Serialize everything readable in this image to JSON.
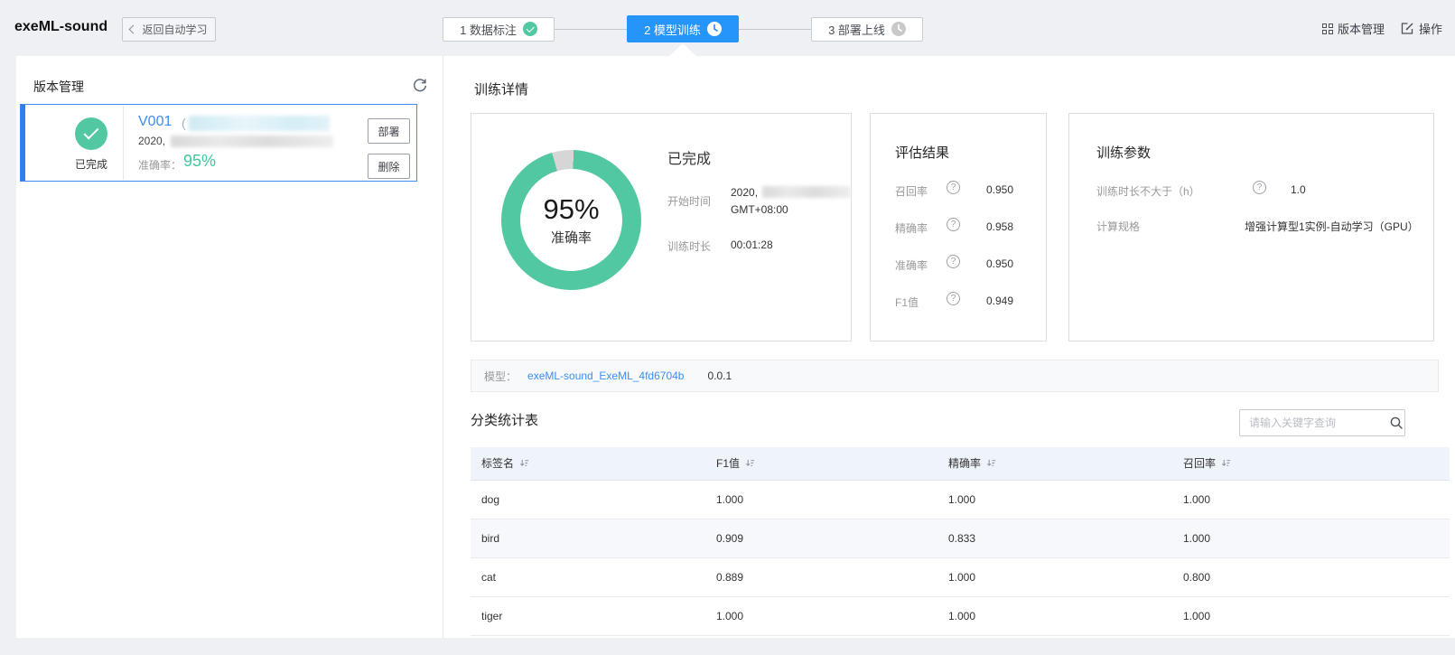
{
  "icons": {
    "help": "?"
  },
  "colors": {
    "accent_blue": "#2595fb",
    "green": "#52c8a2",
    "link_blue": "#3d8df4",
    "metric_green": "#3fc7a0"
  },
  "header": {
    "app_title": "exeML-sound",
    "back_label": "返回自动学习",
    "steps": [
      {
        "label": "1 数据标注",
        "state": "done"
      },
      {
        "label": "2 模型训练",
        "state": "active"
      },
      {
        "label": "3 部署上线",
        "state": "pending"
      }
    ],
    "top_right": [
      {
        "label": "版本管理"
      },
      {
        "label": "操作"
      }
    ]
  },
  "sidebar": {
    "title": "版本管理",
    "version": {
      "status": "已完成",
      "name": "V001",
      "paren": "(",
      "date_prefix": "2020,",
      "metric_label": "准确率：",
      "metric_value": "95%",
      "deploy": "部署",
      "delete": "删除"
    }
  },
  "main": {
    "title": "训练详情",
    "summary": {
      "percent": "95%",
      "percent_label": "准确率",
      "status": "已完成",
      "start_label": "开始时间",
      "start_prefix": "2020,",
      "start_tz": "GMT+08:00",
      "duration_label": "训练时长",
      "duration": "00:01:28"
    },
    "evaluation": {
      "title": "评估结果",
      "rows": [
        {
          "label": "召回率",
          "value": "0.950"
        },
        {
          "label": "精确率",
          "value": "0.958"
        },
        {
          "label": "准确率",
          "value": "0.950"
        },
        {
          "label": "F1值",
          "value": "0.949"
        }
      ]
    },
    "params": {
      "title": "训练参数",
      "rows": [
        {
          "label": "训练时长不大于（h）",
          "value": "1.0"
        },
        {
          "label": "计算规格",
          "value": "增强计算型1实例-自动学习（GPU）"
        }
      ]
    },
    "model": {
      "label": "模型：",
      "link": "exeML-sound_ExeML_4fd6704b",
      "version": "0.0.1"
    },
    "stats": {
      "title": "分类统计表",
      "search_placeholder": "请输入关键字查询",
      "columns": [
        "标签名",
        "F1值",
        "精确率",
        "召回率"
      ],
      "rows": [
        [
          "dog",
          "1.000",
          "1.000",
          "1.000"
        ],
        [
          "bird",
          "0.909",
          "0.833",
          "1.000"
        ],
        [
          "cat",
          "0.889",
          "1.000",
          "0.800"
        ],
        [
          "tiger",
          "1.000",
          "1.000",
          "1.000"
        ]
      ]
    }
  }
}
